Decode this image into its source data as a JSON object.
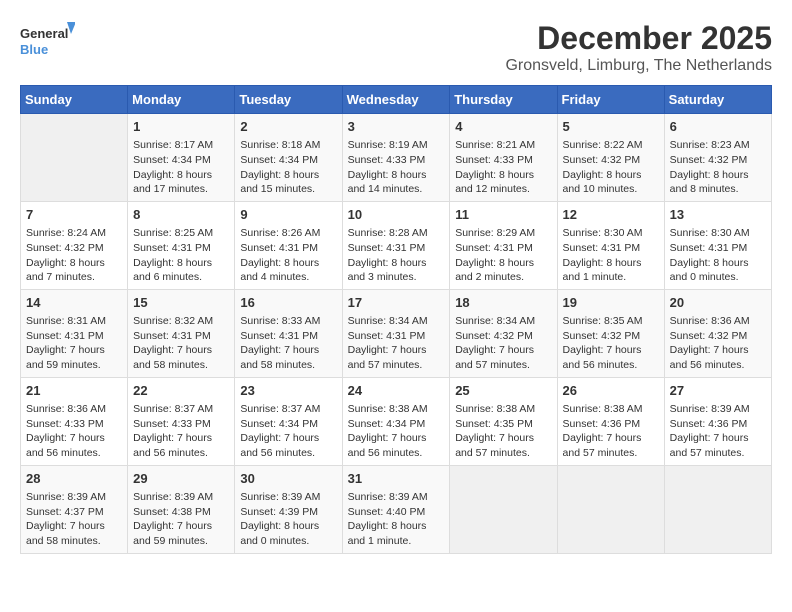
{
  "logo": {
    "text_general": "General",
    "text_blue": "Blue"
  },
  "title": "December 2025",
  "subtitle": "Gronsveld, Limburg, The Netherlands",
  "weekdays": [
    "Sunday",
    "Monday",
    "Tuesday",
    "Wednesday",
    "Thursday",
    "Friday",
    "Saturday"
  ],
  "weeks": [
    [
      {
        "day": "",
        "info": ""
      },
      {
        "day": "1",
        "info": "Sunrise: 8:17 AM\nSunset: 4:34 PM\nDaylight: 8 hours\nand 17 minutes."
      },
      {
        "day": "2",
        "info": "Sunrise: 8:18 AM\nSunset: 4:34 PM\nDaylight: 8 hours\nand 15 minutes."
      },
      {
        "day": "3",
        "info": "Sunrise: 8:19 AM\nSunset: 4:33 PM\nDaylight: 8 hours\nand 14 minutes."
      },
      {
        "day": "4",
        "info": "Sunrise: 8:21 AM\nSunset: 4:33 PM\nDaylight: 8 hours\nand 12 minutes."
      },
      {
        "day": "5",
        "info": "Sunrise: 8:22 AM\nSunset: 4:32 PM\nDaylight: 8 hours\nand 10 minutes."
      },
      {
        "day": "6",
        "info": "Sunrise: 8:23 AM\nSunset: 4:32 PM\nDaylight: 8 hours\nand 8 minutes."
      }
    ],
    [
      {
        "day": "7",
        "info": "Sunrise: 8:24 AM\nSunset: 4:32 PM\nDaylight: 8 hours\nand 7 minutes."
      },
      {
        "day": "8",
        "info": "Sunrise: 8:25 AM\nSunset: 4:31 PM\nDaylight: 8 hours\nand 6 minutes."
      },
      {
        "day": "9",
        "info": "Sunrise: 8:26 AM\nSunset: 4:31 PM\nDaylight: 8 hours\nand 4 minutes."
      },
      {
        "day": "10",
        "info": "Sunrise: 8:28 AM\nSunset: 4:31 PM\nDaylight: 8 hours\nand 3 minutes."
      },
      {
        "day": "11",
        "info": "Sunrise: 8:29 AM\nSunset: 4:31 PM\nDaylight: 8 hours\nand 2 minutes."
      },
      {
        "day": "12",
        "info": "Sunrise: 8:30 AM\nSunset: 4:31 PM\nDaylight: 8 hours\nand 1 minute."
      },
      {
        "day": "13",
        "info": "Sunrise: 8:30 AM\nSunset: 4:31 PM\nDaylight: 8 hours\nand 0 minutes."
      }
    ],
    [
      {
        "day": "14",
        "info": "Sunrise: 8:31 AM\nSunset: 4:31 PM\nDaylight: 7 hours\nand 59 minutes."
      },
      {
        "day": "15",
        "info": "Sunrise: 8:32 AM\nSunset: 4:31 PM\nDaylight: 7 hours\nand 58 minutes."
      },
      {
        "day": "16",
        "info": "Sunrise: 8:33 AM\nSunset: 4:31 PM\nDaylight: 7 hours\nand 58 minutes."
      },
      {
        "day": "17",
        "info": "Sunrise: 8:34 AM\nSunset: 4:31 PM\nDaylight: 7 hours\nand 57 minutes."
      },
      {
        "day": "18",
        "info": "Sunrise: 8:34 AM\nSunset: 4:32 PM\nDaylight: 7 hours\nand 57 minutes."
      },
      {
        "day": "19",
        "info": "Sunrise: 8:35 AM\nSunset: 4:32 PM\nDaylight: 7 hours\nand 56 minutes."
      },
      {
        "day": "20",
        "info": "Sunrise: 8:36 AM\nSunset: 4:32 PM\nDaylight: 7 hours\nand 56 minutes."
      }
    ],
    [
      {
        "day": "21",
        "info": "Sunrise: 8:36 AM\nSunset: 4:33 PM\nDaylight: 7 hours\nand 56 minutes."
      },
      {
        "day": "22",
        "info": "Sunrise: 8:37 AM\nSunset: 4:33 PM\nDaylight: 7 hours\nand 56 minutes."
      },
      {
        "day": "23",
        "info": "Sunrise: 8:37 AM\nSunset: 4:34 PM\nDaylight: 7 hours\nand 56 minutes."
      },
      {
        "day": "24",
        "info": "Sunrise: 8:38 AM\nSunset: 4:34 PM\nDaylight: 7 hours\nand 56 minutes."
      },
      {
        "day": "25",
        "info": "Sunrise: 8:38 AM\nSunset: 4:35 PM\nDaylight: 7 hours\nand 57 minutes."
      },
      {
        "day": "26",
        "info": "Sunrise: 8:38 AM\nSunset: 4:36 PM\nDaylight: 7 hours\nand 57 minutes."
      },
      {
        "day": "27",
        "info": "Sunrise: 8:39 AM\nSunset: 4:36 PM\nDaylight: 7 hours\nand 57 minutes."
      }
    ],
    [
      {
        "day": "28",
        "info": "Sunrise: 8:39 AM\nSunset: 4:37 PM\nDaylight: 7 hours\nand 58 minutes."
      },
      {
        "day": "29",
        "info": "Sunrise: 8:39 AM\nSunset: 4:38 PM\nDaylight: 7 hours\nand 59 minutes."
      },
      {
        "day": "30",
        "info": "Sunrise: 8:39 AM\nSunset: 4:39 PM\nDaylight: 8 hours\nand 0 minutes."
      },
      {
        "day": "31",
        "info": "Sunrise: 8:39 AM\nSunset: 4:40 PM\nDaylight: 8 hours\nand 1 minute."
      },
      {
        "day": "",
        "info": ""
      },
      {
        "day": "",
        "info": ""
      },
      {
        "day": "",
        "info": ""
      }
    ]
  ]
}
